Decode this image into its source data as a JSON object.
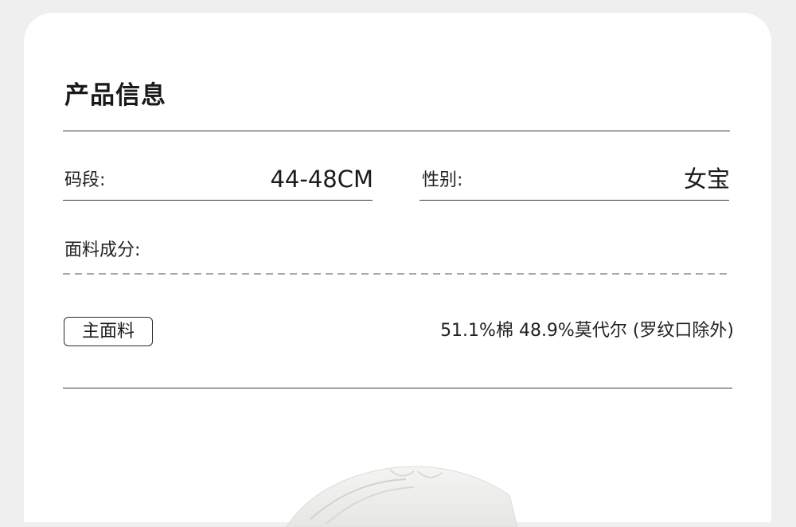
{
  "section": {
    "title": "产品信息"
  },
  "fields": {
    "size_label": "码段:",
    "size_value": "44-48CM",
    "gender_label": "性别:",
    "gender_value": "女宝",
    "fabric_label": "面料成分:"
  },
  "fabric": {
    "tag": "主面料",
    "composition": "51.1%棉 48.9%莫代尔 (罗纹口除外)"
  }
}
